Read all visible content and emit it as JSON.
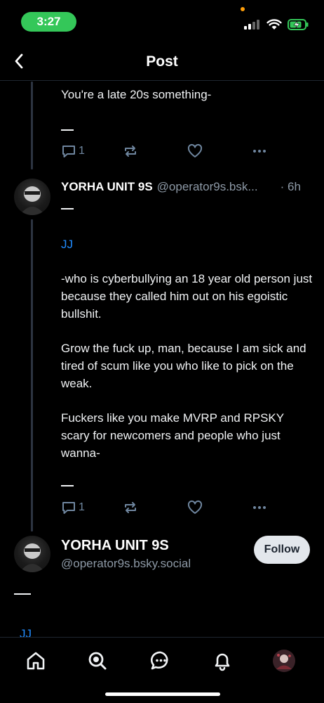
{
  "status_bar": {
    "time": "3:27"
  },
  "header": {
    "title": "Post"
  },
  "parent_post": {
    "text": "You're a late 20s something-",
    "separator": "—",
    "reply_count": "1"
  },
  "reply_post": {
    "display_name": "YORHA UNIT 9S",
    "handle": "@operator9s.bsk...",
    "timestamp": "· 6h",
    "top_separator": "—",
    "mention": "JJ",
    "paragraphs": [
      "-who is cyberbullying an 18 year old person just because they called him out on his egoistic bullshit.",
      "Grow the fuck up, man, because I am sick and tired of scum like you who like to pick on the weak.",
      "Fuckers like you make MVRP and RPSKY scary for newcomers and people who just wanna-"
    ],
    "bottom_separator": "—",
    "reply_count": "1"
  },
  "focused_post": {
    "display_name": "YORHA UNIT 9S",
    "handle": "@operator9s.bsky.social",
    "follow_label": "Follow",
    "separator": "—",
    "partial_mention": "JJ"
  },
  "tab_bar": {
    "items": [
      "home-icon",
      "search-icon",
      "chat-icon",
      "notifications-icon",
      "profile-avatar"
    ]
  },
  "colors": {
    "background": "#000000",
    "text": "#f1f3f5",
    "muted": "#8d99a6",
    "link": "#208bfe",
    "action_icon": "#6f869f",
    "status_pill": "#34c759",
    "follow_bg": "#e3e7ec"
  }
}
